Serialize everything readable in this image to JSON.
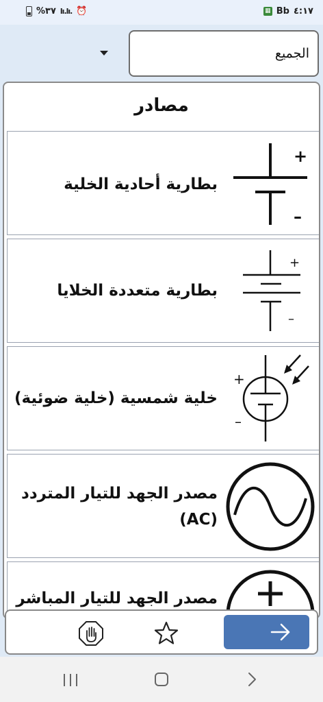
{
  "status": {
    "time": "٤:١٧",
    "carrier": "Bb",
    "battery": "%٣٧",
    "signal": "lı.lı."
  },
  "filter": {
    "selected": "الجميع"
  },
  "panel": {
    "title": "مصادر"
  },
  "items": [
    {
      "label": "بطارية أحادية الخلية",
      "icon": "single-cell-battery-symbol",
      "plus": "+",
      "minus": "–"
    },
    {
      "label": "بطارية متعددة الخلايا",
      "icon": "multi-cell-battery-symbol",
      "plus": "+",
      "minus": "–"
    },
    {
      "label": "خلية شمسية (خلية ضوئية)",
      "icon": "solar-cell-symbol",
      "plus": "+",
      "minus": "–"
    },
    {
      "label": "مصدر الجهد للتيار المتردد (AC)",
      "icon": "ac-voltage-source-symbol"
    },
    {
      "label": "مصدر الجهد للتيار المباشر",
      "icon": "dc-voltage-source-symbol",
      "plus": "+"
    }
  ],
  "toolbar": {
    "next_icon": "arrow-right-icon",
    "favorite_icon": "star-icon",
    "stop_icon": "hand-stop-icon"
  },
  "colors": {
    "accent": "#4a76b5",
    "background": "#dfeaf6"
  }
}
